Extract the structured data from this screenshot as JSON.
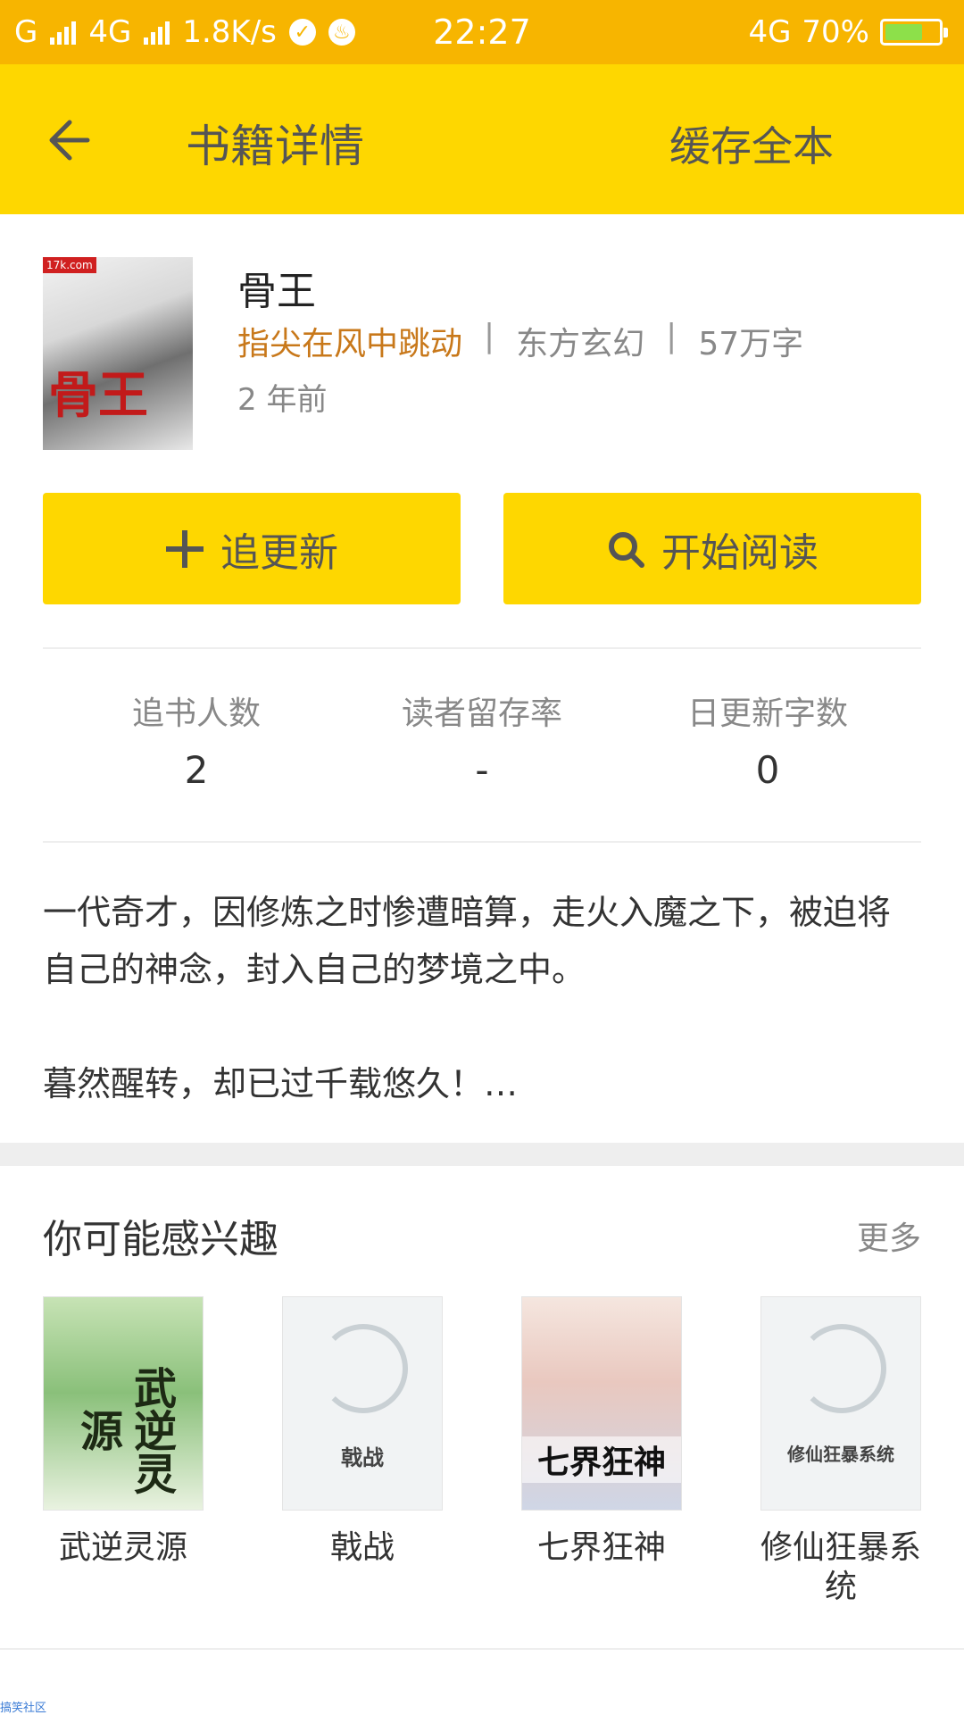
{
  "status_bar": {
    "carrier1": "G",
    "carrier2": "4G",
    "speed": "1.8K/s",
    "time": "22:27",
    "network_right": "4G",
    "battery": "70%",
    "battery_level": 0.7
  },
  "toolbar": {
    "title": "书籍详情",
    "cache_all": "缓存全本"
  },
  "book": {
    "cover_title": "骨王",
    "cover_tag": "17k.com",
    "title": "骨王",
    "author": "指尖在风中跳动",
    "category": "东方玄幻",
    "words": "57万字",
    "sep": "|",
    "updated": "2 年前"
  },
  "actions": {
    "follow": "追更新",
    "read": "开始阅读"
  },
  "stats": [
    {
      "label": "追书人数",
      "value": "2"
    },
    {
      "label": "读者留存率",
      "value": "-"
    },
    {
      "label": "日更新字数",
      "value": "0"
    }
  ],
  "description": {
    "para1": "一代奇才，因修炼之时惨遭暗算，走火入魔之下，被迫将自己的神念，封入自己的梦境之中。",
    "para2": "暮然醒转，却已过千载悠久！…"
  },
  "recommend": {
    "title": "你可能感兴趣",
    "more": "更多",
    "items": [
      {
        "name": "武逆灵源",
        "cover_text": "武逆灵源"
      },
      {
        "name": "戟战",
        "cover_text": "戟战"
      },
      {
        "name": "七界狂神",
        "cover_text": "七界狂神"
      },
      {
        "name": "修仙狂暴系统",
        "cover_text": "修仙狂暴系统"
      }
    ]
  },
  "watermark": "搞笑社区",
  "colors": {
    "status_bar": "#f7b500",
    "toolbar": "#fed700",
    "button": "#fed700",
    "author": "#c8781a"
  }
}
